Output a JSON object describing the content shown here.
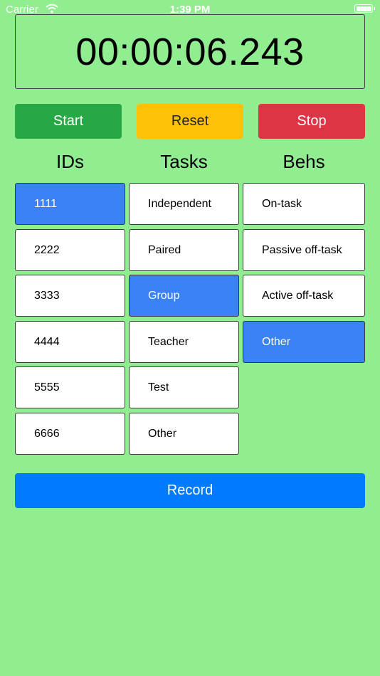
{
  "status_bar": {
    "carrier": "Carrier",
    "time": "1:39 PM"
  },
  "timer": {
    "display": "00:00:06.243"
  },
  "controls": {
    "start_label": "Start",
    "reset_label": "Reset",
    "stop_label": "Stop"
  },
  "columns": {
    "ids": "IDs",
    "tasks": "Tasks",
    "behs": "Behs"
  },
  "ids": [
    "1111",
    "2222",
    "3333",
    "4444",
    "5555",
    "6666"
  ],
  "tasks": [
    "Independent",
    "Paired",
    "Group",
    "Teacher",
    "Test",
    "Other"
  ],
  "behs": [
    "On-task",
    "Passive off-task",
    "Active off-task",
    "Other"
  ],
  "selected": {
    "id": "1111",
    "task": "Group",
    "beh": "Other"
  },
  "record_label": "Record",
  "colors": {
    "background": "#90ee90",
    "start": "#28a745",
    "reset": "#ffc107",
    "stop": "#dc3545",
    "selected": "#3b82f6",
    "record": "#007bff"
  },
  "icons": [
    "wifi-icon",
    "battery-icon"
  ]
}
